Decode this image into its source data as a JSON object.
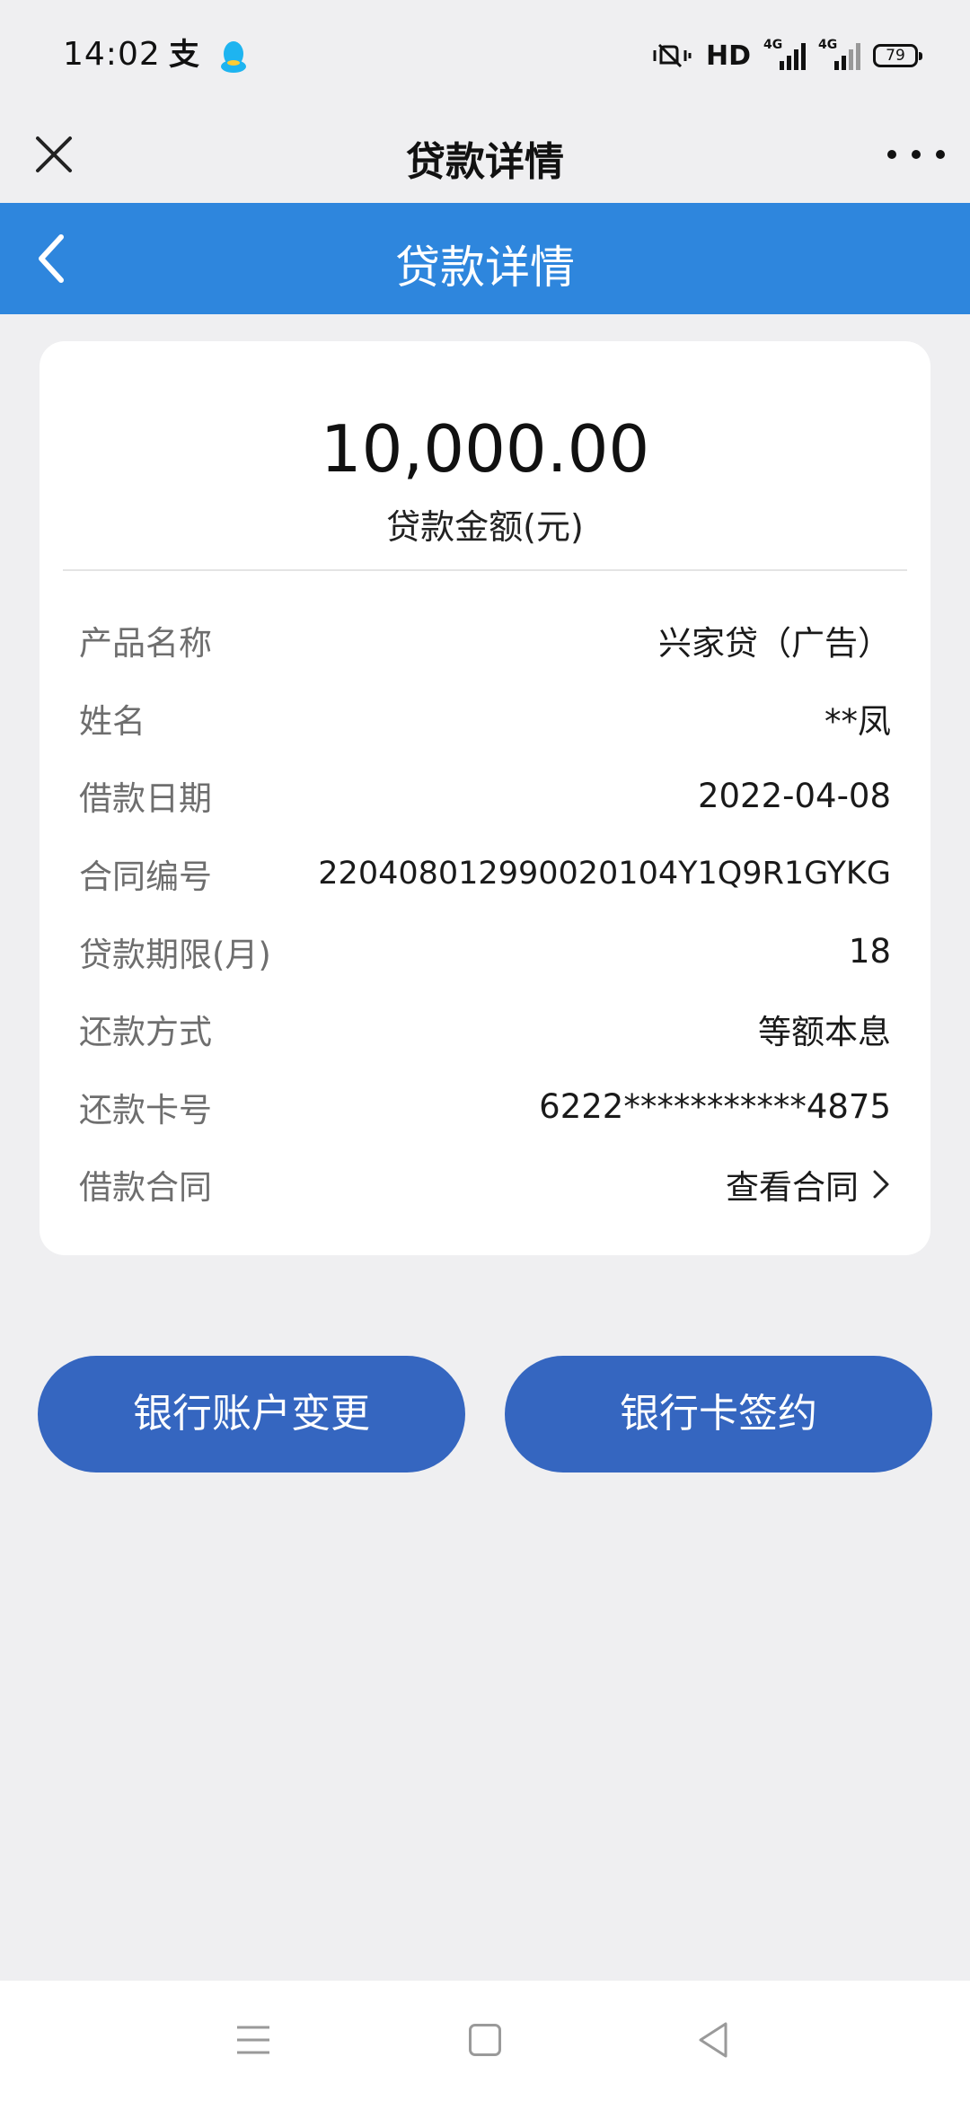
{
  "status_bar": {
    "time": "14:02",
    "network": "HD",
    "signal_1_label": "4G",
    "signal_2_label": "4G",
    "battery": "79",
    "icons": [
      "alipay-icon",
      "qq-icon",
      "vibrate-mute-icon",
      "signal-icon",
      "battery-icon"
    ]
  },
  "top_bar": {
    "title": "贷款详情",
    "icons": [
      "close-icon",
      "more-icon"
    ]
  },
  "header": {
    "title": "贷款详情",
    "color": "#2e86dd",
    "icons": [
      "chevron-left-icon"
    ]
  },
  "loan": {
    "amount": "10,000.00",
    "amount_label": "贷款金额(元)",
    "rows": [
      {
        "label": "产品名称",
        "value": "兴家贷（广告）"
      },
      {
        "label": "姓名",
        "value": "**凤"
      },
      {
        "label": "借款日期",
        "value": "2022-04-08"
      },
      {
        "label": "合同编号",
        "value": "22040801299002010 4Y1Q9R1GYKG"
      },
      {
        "label": "贷款期限(月)",
        "value": "18"
      },
      {
        "label": "还款方式",
        "value": "等额本息"
      },
      {
        "label": "还款卡号",
        "value": "6222***********4875"
      },
      {
        "label": "借款合同",
        "value": "查看合同"
      }
    ]
  },
  "buttons": {
    "account_change": "银行账户变更",
    "card_sign": "银行卡签约",
    "color": "#3566c0"
  },
  "nav_bar": {
    "icons": [
      "menu-icon",
      "home-icon",
      "back-icon"
    ]
  }
}
